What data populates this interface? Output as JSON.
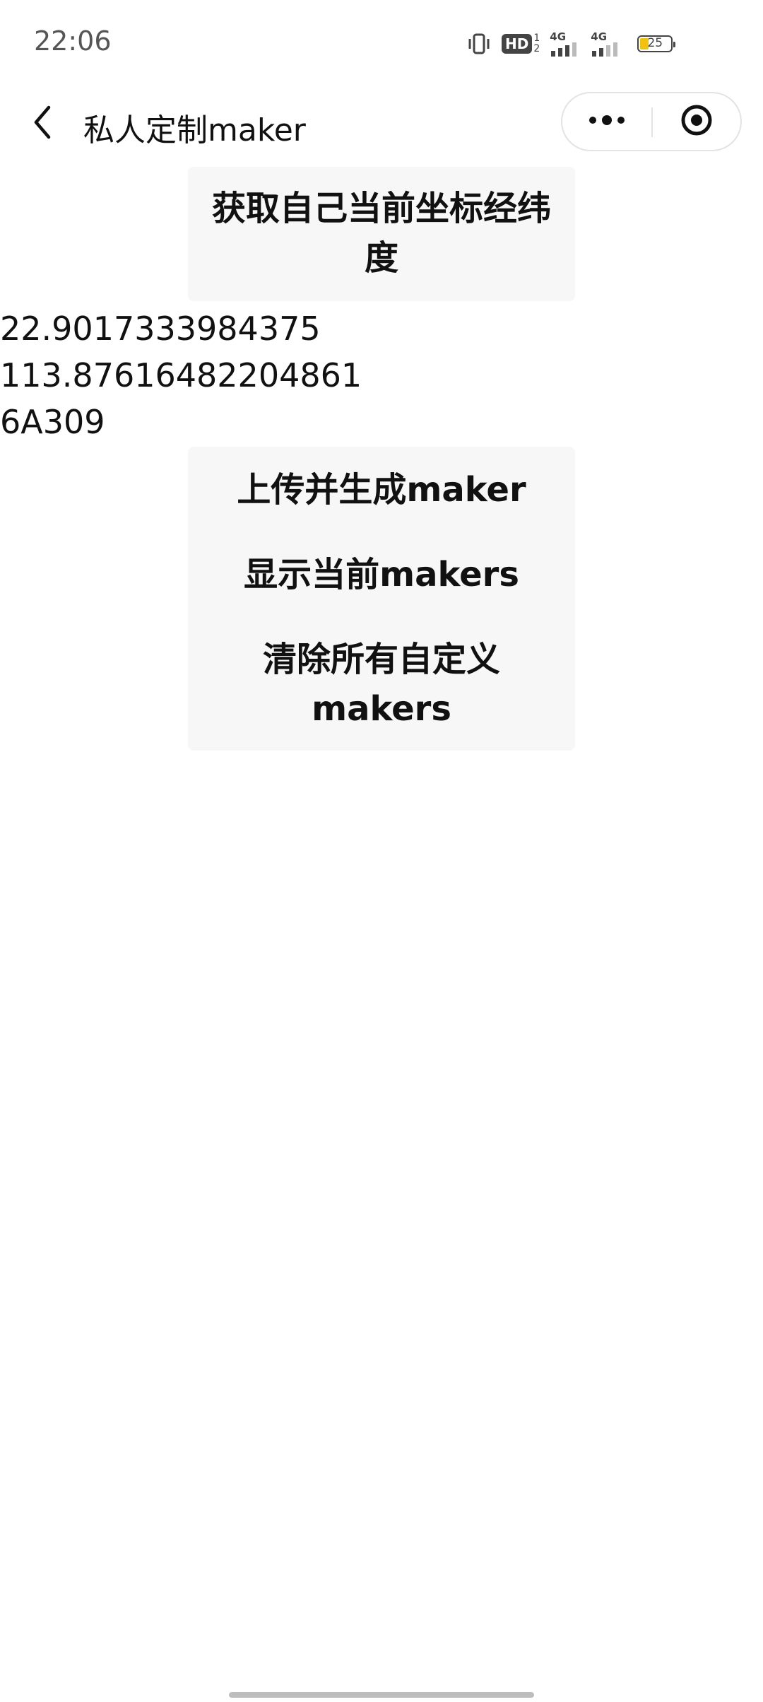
{
  "status_bar": {
    "time": "22:06",
    "hd_label": "HD",
    "hd_top": "1",
    "hd_bottom": "2",
    "signal1_label": "4G",
    "signal2_label": "4G",
    "battery_level": "25",
    "battery_color": "#f4c20d"
  },
  "nav": {
    "title": "私人定制maker",
    "back_icon": "chevron-left-icon",
    "more_icon": "more-dots-icon",
    "close_icon": "target-circle-icon"
  },
  "buttons": {
    "get_location": "获取自己当前坐标经纬度",
    "upload_generate": "上传并生成maker",
    "show_markers": "显示当前makers",
    "clear_markers": "清除所有自定义makers"
  },
  "location": {
    "latitude": "22.9017333984375",
    "longitude": "113.87616482204861",
    "room": "6A309"
  }
}
